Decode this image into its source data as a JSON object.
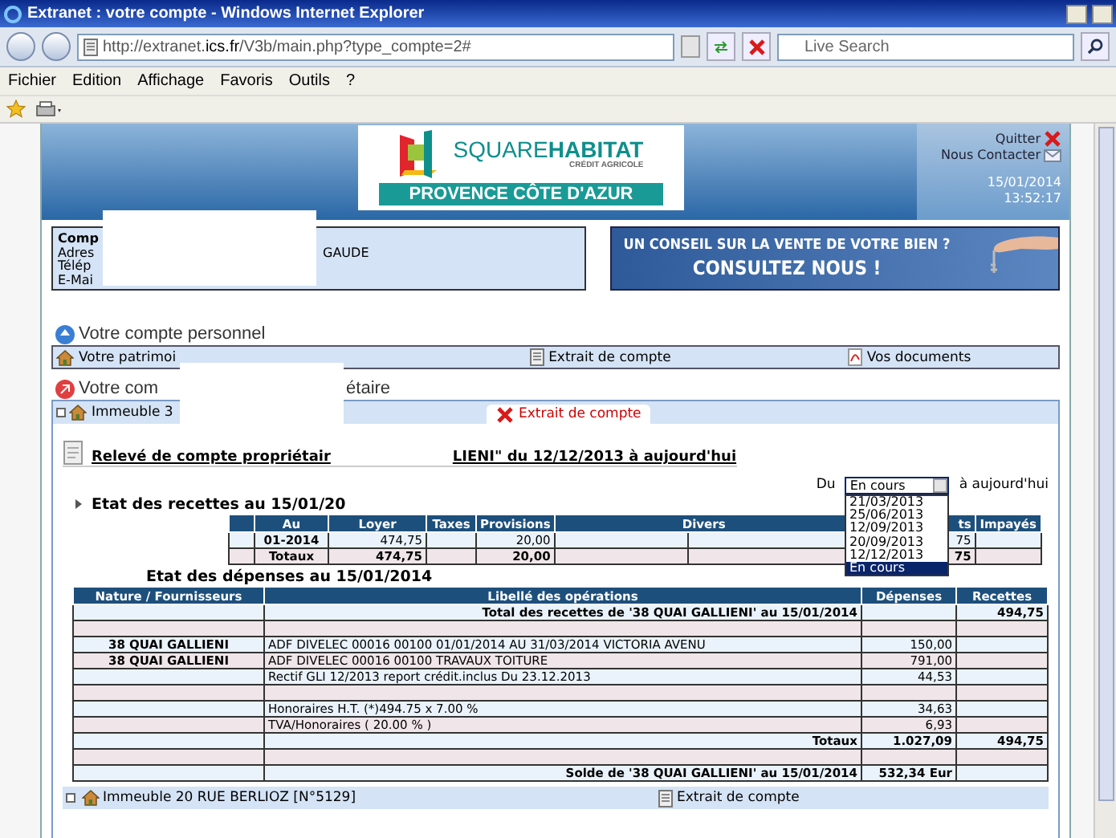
{
  "window": {
    "title": "Extranet : votre compte - Windows Internet Explorer"
  },
  "address_bar": {
    "url_start": "http://extranet.",
    "url_host": "ics.fr",
    "url_end": "/V3b/main.php?type_compte=2#"
  },
  "search": {
    "placeholder": "Live Search"
  },
  "menu": [
    "Fichier",
    "Edition",
    "Affichage",
    "Favoris",
    "Outils",
    "?"
  ],
  "header": {
    "brand_1": "SQUARE",
    "brand_2": "HABITAT",
    "tagline": "CRÉDIT AGRICOLE",
    "region": "PROVENCE CÔTE D'AZUR",
    "links": [
      {
        "label": "Quitter",
        "kind": "quit"
      },
      {
        "label": "Nous Contacter",
        "kind": "contact"
      }
    ],
    "date": "15/01/2014",
    "time": "13:52:17"
  },
  "contact_box": {
    "lines": [
      {
        "label": "Comp",
        "kind": "title"
      },
      {
        "label": "Adres",
        "kind": "field",
        "value": "GAUDE"
      },
      {
        "label": "Télép",
        "kind": "field"
      },
      {
        "label": "E-Mai",
        "kind": "field"
      }
    ]
  },
  "banner": {
    "line_1": "UN CONSEIL SUR LA VENTE DE VOTRE BIEN ?",
    "line_2": "CONSULTEZ NOUS !"
  },
  "personal": {
    "heading": "Votre compte personnel",
    "items": [
      {
        "label": "Votre patrimoi",
        "kind": "home"
      },
      {
        "label": "Extrait de compte",
        "kind": "statement"
      },
      {
        "label": "Vos documents",
        "kind": "pdf"
      }
    ]
  },
  "owner": {
    "heading_start": "Votre com",
    "heading_end": "étaire",
    "property": "Immeuble 3",
    "tab": {
      "label": "Extrait de compte",
      "selected": true
    }
  },
  "statement": {
    "title_start": "Relevé de compte propriétair",
    "title_end": "LIENI\" du 12/12/2013 à aujourd'hui",
    "period": {
      "label": "Du",
      "value": "En cours",
      "suffix": "à aujourd'hui",
      "expanded": true,
      "options": [
        {
          "label": "21/03/2013",
          "selected": false
        },
        {
          "label": "25/06/2013",
          "selected": false
        },
        {
          "label": "12/09/2013",
          "selected": false
        },
        {
          "label": "20/09/2013",
          "selected": false
        },
        {
          "label": "12/12/2013",
          "selected": false
        },
        {
          "label": "En cours",
          "selected": true
        }
      ]
    }
  },
  "receipts": {
    "title": "Etat des recettes au 15/01/20",
    "columns": [
      "Au",
      "Loyer",
      "Taxes",
      "Provisions",
      "Divers",
      "ts",
      "Impayés"
    ],
    "rows": [
      {
        "kind": "data",
        "au": "01-2014",
        "loyer": "474,75",
        "provisions": "20,00",
        "col_ts": "75"
      },
      {
        "kind": "total",
        "au": "Totaux",
        "loyer": "474,75",
        "provisions": "20,00",
        "col_ts": "75"
      }
    ]
  },
  "expenses": {
    "title": "Etat des dépenses au 15/01/2014",
    "columns": [
      "Nature / Fournisseurs",
      "Libellé des opérations",
      "Dépenses",
      "Recettes"
    ],
    "rows": [
      {
        "kind": "total",
        "label": "Total des recettes de '38 QUAI GALLIENI' au 15/01/2014",
        "income": "494,75"
      },
      {
        "kind": "blank"
      },
      {
        "kind": "item",
        "nature": "38 QUAI GALLIENI",
        "label": "ADF DIVELEC 00016 00100 01/01/2014 AU 31/03/2014 VICTORIA AVENU",
        "expense": "150,00"
      },
      {
        "kind": "item",
        "nature": "38 QUAI GALLIENI",
        "label": "ADF DIVELEC 00016 00100 TRAVAUX TOITURE",
        "expense": "791,00"
      },
      {
        "kind": "item",
        "label": "Rectif GLI 12/2013 report crédit.inclus Du 23.12.2013",
        "expense": "44,53"
      },
      {
        "kind": "blank"
      },
      {
        "kind": "item",
        "label": "Honoraires H.T. (*)494.75 x 7.00 %",
        "expense": "34,63"
      },
      {
        "kind": "item",
        "label": "TVA/Honoraires ( 20.00 % )",
        "expense": "6,93"
      },
      {
        "kind": "total",
        "label": "Totaux",
        "expense": "1.027,09",
        "income": "494,75"
      },
      {
        "kind": "blank"
      },
      {
        "kind": "total",
        "label": "Solde de '38 QUAI GALLIENI' au 15/01/2014",
        "expense": "532,34 Eur"
      }
    ]
  },
  "next_property": {
    "label": "Immeuble 20 RUE BERLIOZ [N°5129]",
    "action": "Extrait de compte"
  }
}
